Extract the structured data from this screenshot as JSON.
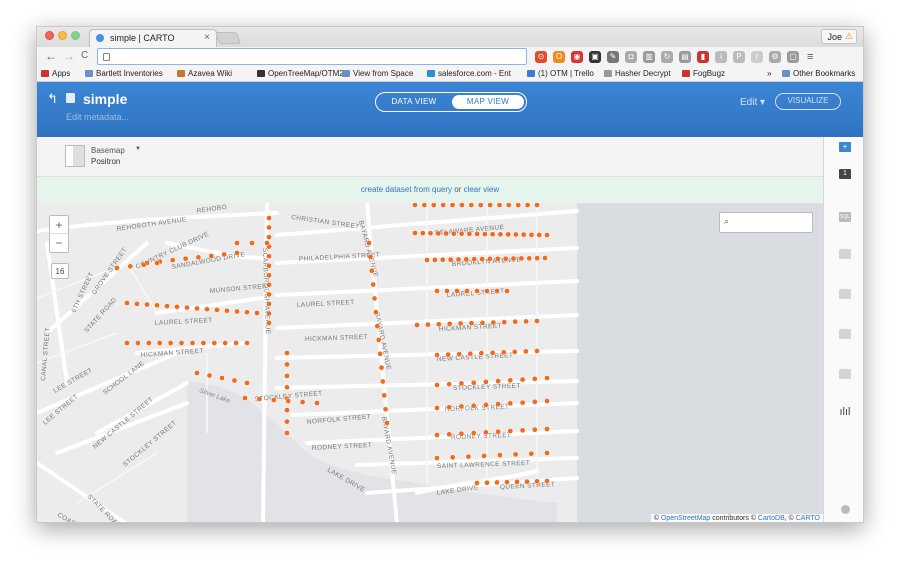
{
  "browser": {
    "tab_title": "simple | CARTO",
    "tab_close": "×",
    "user_name": "Joe",
    "user_warning": "⚠",
    "url": "",
    "nav": {
      "back": "←",
      "forward": "→",
      "reload": "C"
    },
    "menu_icon": "≡",
    "extensions": [
      {
        "name": "extension-red-icon",
        "color": "#e34c26",
        "glyph": "⊙"
      },
      {
        "name": "extension-orange-icon",
        "color": "#f08a1d",
        "glyph": "O"
      },
      {
        "name": "extension-red2-icon",
        "color": "#d33",
        "glyph": "◉"
      },
      {
        "name": "extension-dark-icon",
        "color": "#333",
        "glyph": "▣"
      },
      {
        "name": "extension-eyedropper-icon",
        "color": "#777",
        "glyph": "✎"
      },
      {
        "name": "extension-camera-icon",
        "color": "#aaa",
        "glyph": "◘"
      },
      {
        "name": "extension-chart-icon",
        "color": "#999",
        "glyph": "▥"
      },
      {
        "name": "extension-refresh-icon",
        "color": "#aaa",
        "glyph": "↻"
      },
      {
        "name": "extension-pages-icon",
        "color": "#999",
        "glyph": "▤"
      },
      {
        "name": "extension-bookmark-icon",
        "color": "#c33",
        "glyph": "▮"
      },
      {
        "name": "extension-info-icon",
        "color": "#bbb",
        "glyph": "i"
      },
      {
        "name": "extension-p-icon",
        "color": "#bbb",
        "glyph": "P"
      },
      {
        "name": "extension-r-icon",
        "color": "#ccc",
        "glyph": "r"
      },
      {
        "name": "extension-gear-icon",
        "color": "#aaa",
        "glyph": "⚙"
      },
      {
        "name": "extension-shield-icon",
        "color": "#999",
        "glyph": "▢"
      }
    ],
    "bookmarks": [
      {
        "label": "Apps",
        "color": "#c33"
      },
      {
        "label": "Bartlett Inventories",
        "color": "#6b8fc7"
      },
      {
        "label": "Azavea Wiki",
        "color": "#c4782f"
      },
      {
        "label": "OpenTreeMap/OTM2",
        "color": "#333"
      },
      {
        "label": "View from Space",
        "color": "#6b8fc7"
      },
      {
        "label": "salesforce.com - Ent",
        "color": "#2a8fd6"
      },
      {
        "label": "(1) OTM | Trello",
        "color": "#3b7ed0"
      },
      {
        "label": "Hasher Decrypt",
        "color": "#999"
      },
      {
        "label": "FogBugz",
        "color": "#c33"
      },
      {
        "label": "»",
        "color": ""
      },
      {
        "label": "Other Bookmarks",
        "color": "#6b8fc7"
      }
    ]
  },
  "carto": {
    "back_icon": "↰",
    "dataset_title": "simple",
    "edit_metadata": "Edit metadata...",
    "data_view": "DATA VIEW",
    "map_view": "MAP VIEW",
    "edit_menu": "Edit ▾",
    "visualize": "VISUALIZE",
    "basemap_label": "Basemap",
    "basemap_value": "Positron",
    "notice_prefix": "create dataset from query",
    "notice_or": " or ",
    "notice_clear": "clear view",
    "zoom_in": "+",
    "zoom_out": "−",
    "zoom_level": "16",
    "search_icon": "⌕",
    "attribution": {
      "prefix": "© ",
      "osm": "OpenStreetMap",
      "mid": " contributors © ",
      "cartodb": "CartoDB",
      "sep": ", © ",
      "carto": "CARTO"
    },
    "right_panel": {
      "add": "+",
      "layer": "1",
      "sql": "SQL",
      "filters": "ılıl"
    }
  },
  "map": {
    "water_label": "Silver Lake",
    "streets": [
      {
        "label": "REHOBOTH AVENUE"
      },
      {
        "label": "REHOBO"
      },
      {
        "label": "CHRISTIAN STREET"
      },
      {
        "label": "DELAWARE AVENUE"
      },
      {
        "label": "COUNTRY CLUB DRIVE"
      },
      {
        "label": "PHILADELPHIA STREET"
      },
      {
        "label": "BROOKLYN AVENUE"
      },
      {
        "label": "SANDALWOOD DRIVE"
      },
      {
        "label": "GROVE STREET"
      },
      {
        "label": "6TH STREET"
      },
      {
        "label": "STATE ROAD"
      },
      {
        "label": "MUNSON STREET"
      },
      {
        "label": "LAUREL STREET"
      },
      {
        "label": "LAUREL STREET"
      },
      {
        "label": "CANAL STREET"
      },
      {
        "label": "LAUREL STREET"
      },
      {
        "label": "HICKMAN STREET"
      },
      {
        "label": "HICKMAN STREET"
      },
      {
        "label": "HICKMAN STREET"
      },
      {
        "label": "NEW CASTLE STREET"
      },
      {
        "label": "LEE STREET"
      },
      {
        "label": "SCHOOL LANE"
      },
      {
        "label": "STOCKLEY STREET"
      },
      {
        "label": "STOCKLEY STREET"
      },
      {
        "label": "LEE STREET"
      },
      {
        "label": "NEW CASTLE STREET"
      },
      {
        "label": "STOCKLEY STREET"
      },
      {
        "label": "NORFOLK STREET"
      },
      {
        "label": "NORFOLK STREET"
      },
      {
        "label": "RODNEY STREET"
      },
      {
        "label": "RODNEY STREET"
      },
      {
        "label": "SAINT LAWRENCE STREET"
      },
      {
        "label": "LAKE DRIVE"
      },
      {
        "label": "LAKE DRIVE"
      },
      {
        "label": "QUEEN STREET"
      },
      {
        "label": "STATE ROAD"
      },
      {
        "label": "COASTAL"
      },
      {
        "label": "SCARBOROUGH AVENUE"
      },
      {
        "label": "BAYARD AVENUE"
      },
      {
        "label": "BAYARD AVENUE"
      },
      {
        "label": "BAYARD AVENUE"
      }
    ],
    "point_color": "#f26a1c"
  }
}
